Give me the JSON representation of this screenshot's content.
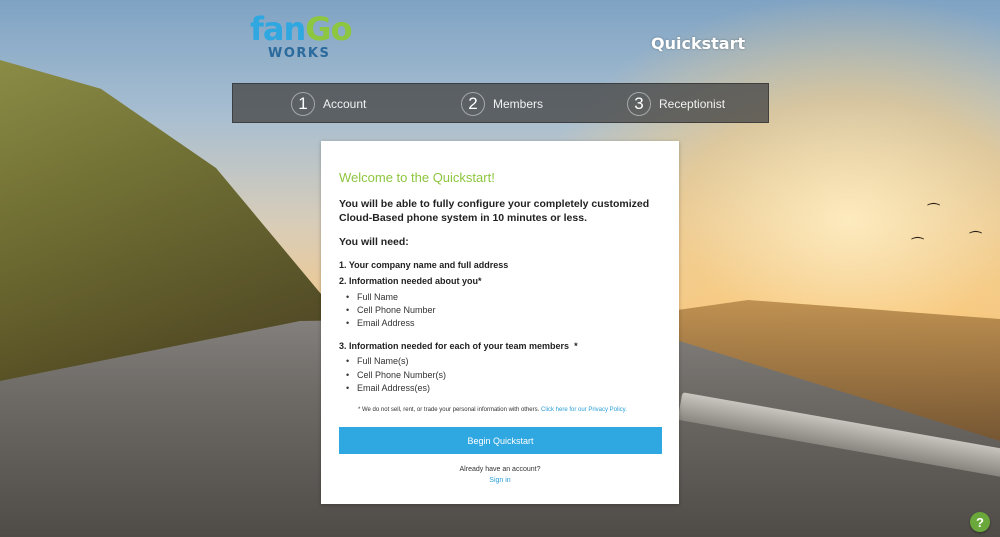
{
  "logo": {
    "part1": "fan",
    "part2": "Go",
    "sub": "WORKS"
  },
  "header": {
    "title": "Quickstart"
  },
  "steps": [
    {
      "num": "1",
      "label": "Account"
    },
    {
      "num": "2",
      "label": "Members"
    },
    {
      "num": "3",
      "label": "Receptionist"
    }
  ],
  "card": {
    "welcome": "Welcome to the Quickstart!",
    "intro": "You will be able to fully configure your completely customized Cloud-Based phone system in 10 minutes or less.",
    "need_heading": "You will need:",
    "req1": "1. Your company name and full address",
    "req2": "2. Information needed about you",
    "req2_items": [
      "Full Name",
      "Cell Phone Number",
      "Email Address"
    ],
    "req3": "3. Information needed for each of your team members",
    "req3_items": [
      "Full Name(s)",
      "Cell Phone Number(s)",
      "Email Address(es)"
    ],
    "star": "*",
    "privacy_text": "* We do not sell, rent, or trade your personal information with others.",
    "privacy_link": "Click here for our Privacy Policy.",
    "begin_button": "Begin Quickstart",
    "have_account": "Already have an account?",
    "sign_in": "Sign in"
  },
  "help": {
    "label": "?"
  },
  "colors": {
    "brand_blue": "#2fa7e0",
    "brand_green": "#8dc63f"
  }
}
